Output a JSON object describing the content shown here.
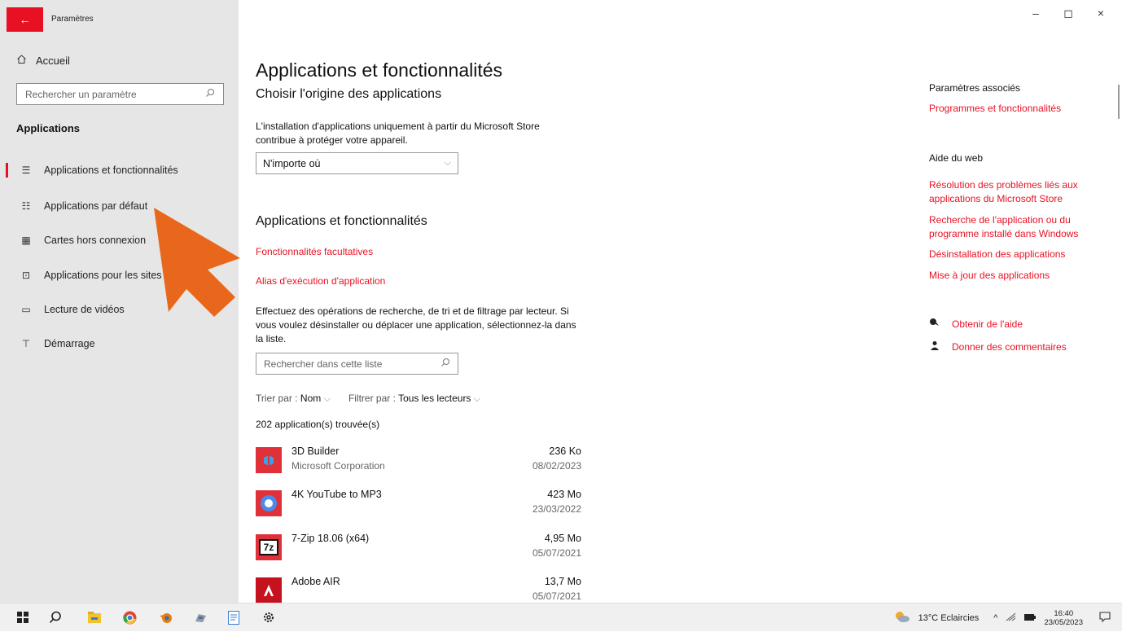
{
  "window": {
    "title": "Paramètres",
    "back_glyph": "←",
    "controls": {
      "minimize": "–",
      "maximize": "◻",
      "close": "×"
    }
  },
  "sidebar": {
    "home": {
      "label": "Accueil",
      "icon": "home-icon"
    },
    "search_placeholder": "Rechercher un paramètre",
    "section": "Applications",
    "items": [
      {
        "label": "Applications et fonctionnalités",
        "icon": "apps-list-icon",
        "active": true
      },
      {
        "label": "Applications par défaut",
        "icon": "default-apps-icon",
        "active": false
      },
      {
        "label": "Cartes hors connexion",
        "icon": "map-icon",
        "active": false
      },
      {
        "label": "Applications pour les sites web",
        "icon": "website-apps-icon",
        "active": false
      },
      {
        "label": "Lecture de vidéos",
        "icon": "video-icon",
        "active": false
      },
      {
        "label": "Démarrage",
        "icon": "startup-icon",
        "active": false
      }
    ]
  },
  "annotation": {
    "color": "#e8671c"
  },
  "main": {
    "title": "Applications et fonctionnalités",
    "origin_heading": "Choisir l'origine des applications",
    "origin_desc": "L'installation d'applications uniquement à partir du Microsoft Store contribue à protéger votre appareil.",
    "origin_value": "N'importe où",
    "features_heading": "Applications et fonctionnalités",
    "optional_features_link": "Fonctionnalités facultatives",
    "alias_link": "Alias d'exécution d'application",
    "list_desc": "Effectuez des opérations de recherche, de tri et de filtrage par lecteur. Si vous voulez désinstaller ou déplacer une application, sélectionnez-la dans la liste.",
    "list_search_placeholder": "Rechercher dans cette liste",
    "sort_label": "Trier par : ",
    "sort_value": "Nom",
    "filter_label": "Filtrer par : ",
    "filter_value": "Tous les lecteurs",
    "count": "202 application(s) trouvée(s)",
    "apps": [
      {
        "name": "3D Builder",
        "publisher": "Microsoft Corporation",
        "size": "236 Ko",
        "date": "08/02/2023",
        "icon_color": "#e0303a",
        "icon": "3d-builder-icon"
      },
      {
        "name": "4K YouTube to MP3",
        "publisher": "",
        "size": "423 Mo",
        "date": "23/03/2022",
        "icon_color": "#e0303a",
        "icon": "youtube-mp3-icon"
      },
      {
        "name": "7-Zip 18.06 (x64)",
        "publisher": "",
        "size": "4,95 Mo",
        "date": "05/07/2021",
        "icon_color": "#e0303a",
        "icon": "7zip-icon"
      },
      {
        "name": "Adobe AIR",
        "publisher": "",
        "size": "13,7 Mo",
        "date": "05/07/2021",
        "icon_color": "#c5121f",
        "icon": "adobe-air-icon"
      }
    ]
  },
  "right": {
    "related_heading": "Paramètres associés",
    "related_link": "Programmes et fonctionnalités",
    "web_help_heading": "Aide du web",
    "web_links": [
      "Résolution des problèmes liés aux applications du Microsoft Store",
      "Recherche de l'application ou du programme installé dans Windows",
      "Désinstallation des applications",
      "Mise à jour des applications"
    ],
    "get_help": "Obtenir de l'aide",
    "feedback": "Donner des commentaires"
  },
  "taskbar": {
    "icons": [
      "windows-start-icon",
      "search-icon",
      "file-explorer-icon",
      "chrome-icon",
      "blender-icon",
      "app-icon",
      "notepad-icon",
      "settings-gear-icon"
    ],
    "weather": "13°C  Eclaircies",
    "tray_arrow": "^",
    "time": "16:40",
    "date": "23/05/2023"
  }
}
